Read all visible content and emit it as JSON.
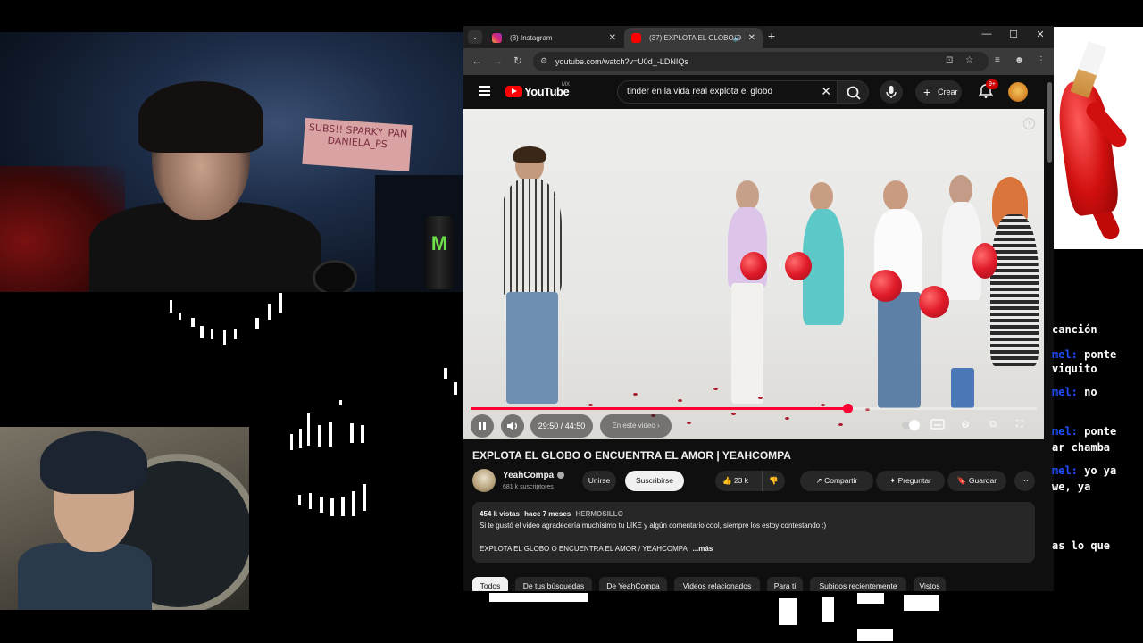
{
  "browser": {
    "tabs": [
      {
        "label": "(3) Instagram",
        "active": false
      },
      {
        "label": "(37) EXPLOTA EL GLOBO O",
        "active": true
      }
    ],
    "url": "youtube.com/watch?v=U0d_-LDNIQs"
  },
  "youtube": {
    "logo_text": "YouTube",
    "country_code": "MX",
    "search_query": "tinder en la vida real explota el globo",
    "create_label": "Crear",
    "notif_badge": "9+",
    "player": {
      "time": "29:50 / 44:50",
      "chapter_label": "En este video",
      "progress": 0.666
    },
    "video": {
      "title": "EXPLOTA EL GLOBO O ENCUENTRA EL AMOR | YEAHCOMPA",
      "channel": "YeahCompa",
      "subscribers": "681 k suscriptores",
      "join_label": "Unirse",
      "subscribe_label": "Suscribirse",
      "likes": "23 k",
      "share_label": "Compartir",
      "ask_label": "Preguntar",
      "save_label": "Guardar",
      "views": "454 k vistas",
      "age": "hace 7 meses",
      "tag": "HERMOSILLO",
      "desc_line1": "Si te gustó el video agradecería muchísimo tu LIKE y algún comentario cool, siempre los estoy contestando :)",
      "desc_line2": "EXPLOTA EL GLOBO O ENCUENTRA EL AMOR / YEAHCOMPA",
      "more_label": "...más"
    },
    "chips": [
      "Todos",
      "De tus búsquedas",
      "De YeahCompa",
      "Videos relacionados",
      "Para ti",
      "Subidos recientemente",
      "Vistos"
    ]
  },
  "webcam": {
    "sign_text": "SUBS!! SPARKY_PAN DANIELA_PS",
    "can_logo": "M"
  },
  "chat": {
    "lines": [
      {
        "user": "",
        "text": "canción"
      },
      {
        "user": "mel:",
        "text": " ponte"
      },
      {
        "user": "",
        "text": "viquito"
      },
      {
        "user": "mel:",
        "text": " no"
      },
      {
        "user": "mel:",
        "text": " ponte"
      },
      {
        "user": "",
        "text": "ar chamba"
      },
      {
        "user": "mel:",
        "text": " yo ya"
      },
      {
        "user": "",
        "text": "we, ya"
      },
      {
        "user": "",
        "text": "as lo que"
      }
    ]
  }
}
